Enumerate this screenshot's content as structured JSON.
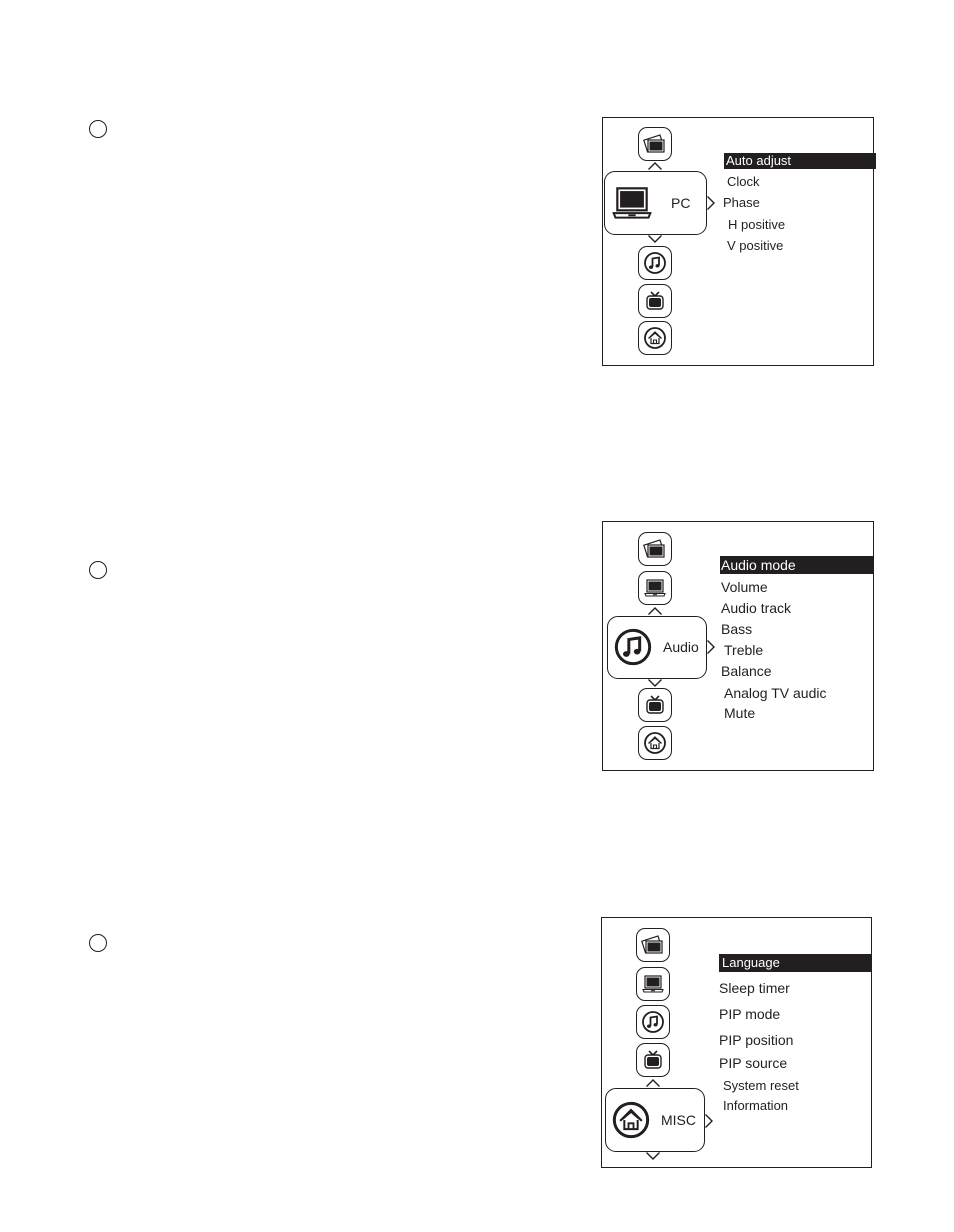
{
  "steps": [
    {
      "category_label": "PC",
      "selected_icon": "pc-icon",
      "menu_items": [
        "Auto adjust",
        "Clock",
        "Phase",
        "H positive",
        "V positive"
      ],
      "selected_item": "Auto adjust"
    },
    {
      "category_label": "Audio",
      "selected_icon": "audio-icon",
      "menu_items": [
        "Audio mode",
        "Volume",
        "Audio track",
        "Bass",
        "Treble",
        "Balance",
        "Analog TV audic",
        "Mute"
      ],
      "selected_item": "Audio mode"
    },
    {
      "category_label": "MISC",
      "selected_icon": "misc-home-icon",
      "menu_items": [
        "Language",
        "Sleep timer",
        "PIP mode",
        "PIP position",
        "PIP source",
        "System reset",
        "Information"
      ],
      "selected_item": "Language"
    }
  ],
  "category_icons": [
    "picture-icon",
    "pc-icon",
    "audio-icon",
    "tv-icon",
    "misc-home-icon"
  ],
  "colors": {
    "ink": "#231f20",
    "highlight_text": "#ffffff",
    "background": "#ffffff"
  }
}
